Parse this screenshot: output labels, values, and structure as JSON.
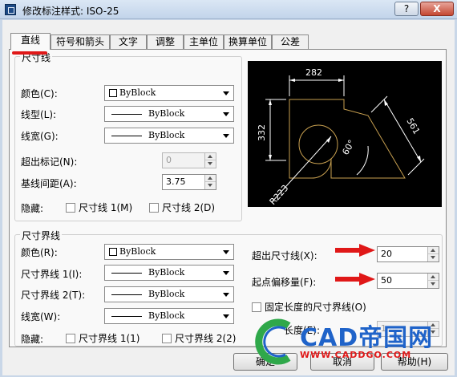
{
  "window": {
    "title": "修改标注样式: ISO-25",
    "help_label": "?",
    "close_label": "X"
  },
  "tabs": [
    {
      "label": "直线"
    },
    {
      "label": "符号和箭头"
    },
    {
      "label": "文字"
    },
    {
      "label": "调整"
    },
    {
      "label": "主单位"
    },
    {
      "label": "换算单位"
    },
    {
      "label": "公差"
    }
  ],
  "dim_lines": {
    "title": "尺寸线",
    "color": {
      "label": "颜色(C):",
      "value": "ByBlock"
    },
    "linetype": {
      "label": "线型(L):",
      "value": "ByBlock"
    },
    "lineweight": {
      "label": "线宽(G):",
      "value": "ByBlock"
    },
    "extend_beyond_ticks": {
      "label": "超出标记(N):",
      "value": "0"
    },
    "baseline_spacing": {
      "label": "基线间距(A):",
      "value": "3.75"
    },
    "suppress": {
      "label": "隐藏:",
      "opt1": "尺寸线 1(M)",
      "opt2": "尺寸线 2(D)"
    }
  },
  "ext_lines": {
    "title": "尺寸界线",
    "color": {
      "label": "颜色(R):",
      "value": "ByBlock"
    },
    "linetype1": {
      "label": "尺寸界线 1(I):",
      "value": "ByBlock"
    },
    "linetype2": {
      "label": "尺寸界线 2(T):",
      "value": "ByBlock"
    },
    "lineweight": {
      "label": "线宽(W):",
      "value": "ByBlock"
    },
    "suppress": {
      "label": "隐藏:",
      "opt1": "尺寸界线 1(1)",
      "opt2": "尺寸界线 2(2)"
    },
    "extend_beyond": {
      "label": "超出尺寸线(X):",
      "value": "20"
    },
    "offset_origin": {
      "label": "起点偏移量(F):",
      "value": "50"
    },
    "fixed_length": {
      "label": "固定长度的尺寸界线(O)"
    },
    "length": {
      "label": "长度(E):",
      "value": "1"
    }
  },
  "preview": {
    "dim_top": "282",
    "dim_left": "332",
    "dim_slant": "561",
    "dim_angle": "60°",
    "dim_radius": "R223"
  },
  "buttons": {
    "ok": "确定",
    "cancel": "取消",
    "help": "帮助(H)"
  },
  "watermark": {
    "brand": "CAD帝国网",
    "url": "WWW.CADDGO.COM"
  },
  "colors": {
    "accent_red": "#e01818",
    "preview_line": "#c8a050",
    "preview_dim": "#ffffff",
    "brand_blue": "#1f63c9"
  }
}
